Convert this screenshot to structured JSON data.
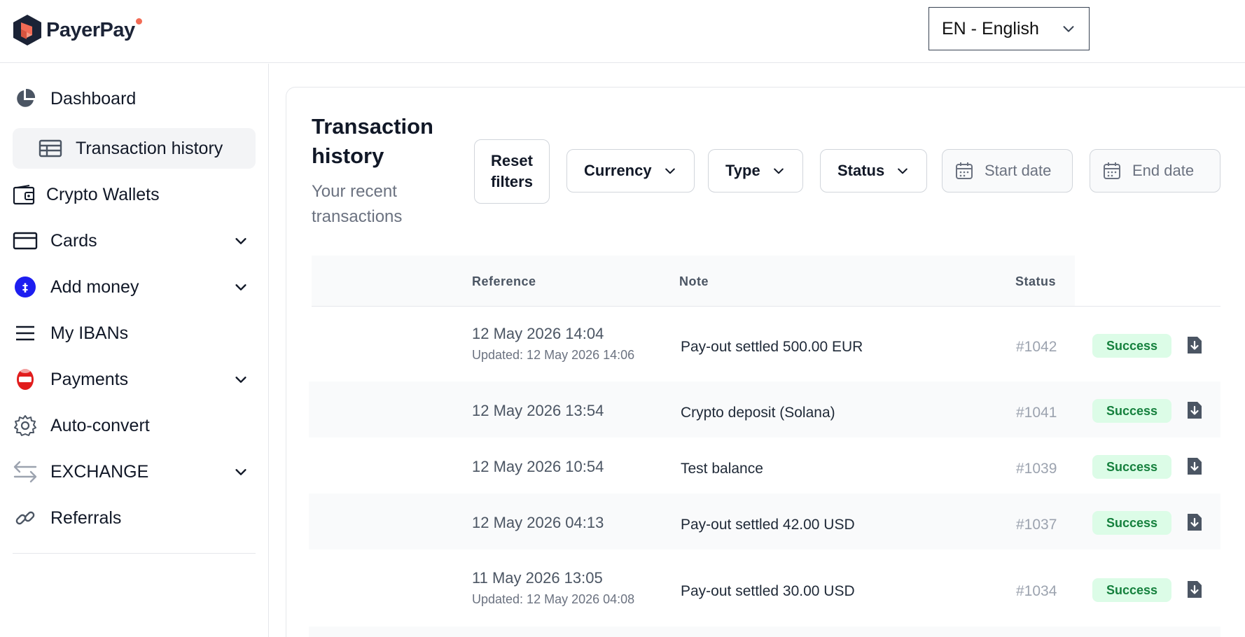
{
  "brand": {
    "name": "PayerPay"
  },
  "language": {
    "selected": "EN - English"
  },
  "sidebar": {
    "items": [
      {
        "label": "Dashboard",
        "icon": "pie-chart-icon"
      },
      {
        "label": "Transaction history",
        "icon": "table-icon",
        "active": true
      },
      {
        "label": "Crypto Wallets",
        "icon": "wallet-icon"
      },
      {
        "label": "Cards",
        "icon": "card-icon",
        "expandable": true
      },
      {
        "label": "Add money",
        "icon": "add-money-icon",
        "expandable": true
      },
      {
        "label": "My IBANs",
        "icon": "menu-lines-icon"
      },
      {
        "label": "Payments",
        "icon": "payments-icon",
        "expandable": true
      },
      {
        "label": "Auto-convert",
        "icon": "gear-icon"
      },
      {
        "label": "EXCHANGE",
        "icon": "exchange-arrows-icon",
        "expandable": true
      },
      {
        "label": "Referrals",
        "icon": "link-icon"
      }
    ]
  },
  "page": {
    "title": "Transaction history",
    "subtitle": "Your recent transactions"
  },
  "filters": {
    "reset_label": "Reset filters",
    "currency_label": "Currency",
    "type_label": "Type",
    "status_label": "Status",
    "start_date_placeholder": "Start date",
    "end_date_placeholder": "End date"
  },
  "table": {
    "headers": {
      "reference": "Reference",
      "note": "Note",
      "status": "Status"
    },
    "rows": [
      {
        "date": "12 May 2026 14:04",
        "updated": "Updated: 12 May 2026 14:06",
        "note": "Pay-out settled 500.00 EUR",
        "ref": "#1042",
        "status": "Success"
      },
      {
        "date": "12 May 2026 13:54",
        "updated": "",
        "note": "Crypto deposit (Solana)",
        "ref": "#1041",
        "status": "Success"
      },
      {
        "date": "12 May 2026 10:54",
        "updated": "",
        "note": "Test balance",
        "ref": "#1039",
        "status": "Success"
      },
      {
        "date": "12 May 2026 04:13",
        "updated": "",
        "note": "Pay-out settled 42.00 USD",
        "ref": "#1037",
        "status": "Success"
      },
      {
        "date": "11 May 2026 13:05",
        "updated": "Updated: 12 May 2026 04:08",
        "note": "Pay-out settled 30.00 USD",
        "ref": "#1034",
        "status": "Success"
      }
    ]
  },
  "colors": {
    "accent_orange": "#f26b55",
    "brand_navy": "#1b2336",
    "success_bg": "#dcfce7",
    "success_text": "#15803d"
  }
}
